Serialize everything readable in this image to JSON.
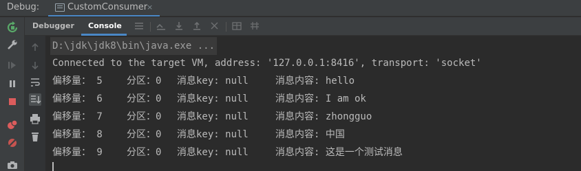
{
  "window": {
    "debug_label": "Debug:",
    "run_tab": {
      "label": "CustomConsumer",
      "close_glyph": "×",
      "icon": "run-config-icon"
    }
  },
  "left_toolbar": {
    "icons": [
      "rerun-icon",
      "settings-wrench-icon",
      "resume-icon",
      "pause-icon",
      "stop-icon",
      "view-breakpoints-icon",
      "mute-breakpoints-icon",
      "camera-icon"
    ]
  },
  "sub_tabs": {
    "tabs": [
      {
        "label": "Debugger",
        "active": false
      },
      {
        "label": "Console",
        "active": true
      }
    ],
    "icons": [
      "hamburger-menu-icon",
      "show-execution-point-icon",
      "step-over-icon",
      "step-into-icon",
      "step-out-icon",
      "force-step-icon",
      "evaluate-table-icon",
      "trace-grid-icon"
    ]
  },
  "gutter": {
    "icons": [
      "scroll-up-icon",
      "scroll-down-icon",
      "soft-wrap-icon",
      "scroll-to-end-icon",
      "print-icon",
      "clear-all-icon"
    ]
  },
  "console": {
    "command": "D:\\jdk\\jdk8\\bin\\java.exe ...",
    "connected": "Connected to the target VM, address: '127.0.0.1:8416', transport: 'socket'",
    "rows": [
      {
        "offset": "偏移量： 5",
        "partition": "分区：0",
        "key": "消息key: null",
        "content": "消息内容: hello"
      },
      {
        "offset": "偏移量： 6",
        "partition": "分区：0",
        "key": "消息key: null",
        "content": "消息内容: I am ok"
      },
      {
        "offset": "偏移量： 7",
        "partition": "分区：0",
        "key": "消息key: null",
        "content": "消息内容: zhongguo"
      },
      {
        "offset": "偏移量： 8",
        "partition": "分区：0",
        "key": "消息key: null",
        "content": "消息内容: 中国"
      },
      {
        "offset": "偏移量： 9",
        "partition": "分区：0",
        "key": "消息key: null",
        "content": "消息内容: 这是一个测试消息"
      }
    ]
  },
  "colors": {
    "background": "#2b2b2b",
    "toolbar": "#3c3f41",
    "accent": "#4a88c7",
    "rerun_green": "#59a869",
    "stop_red": "#db5c5c",
    "text": "#bbbbbb"
  }
}
